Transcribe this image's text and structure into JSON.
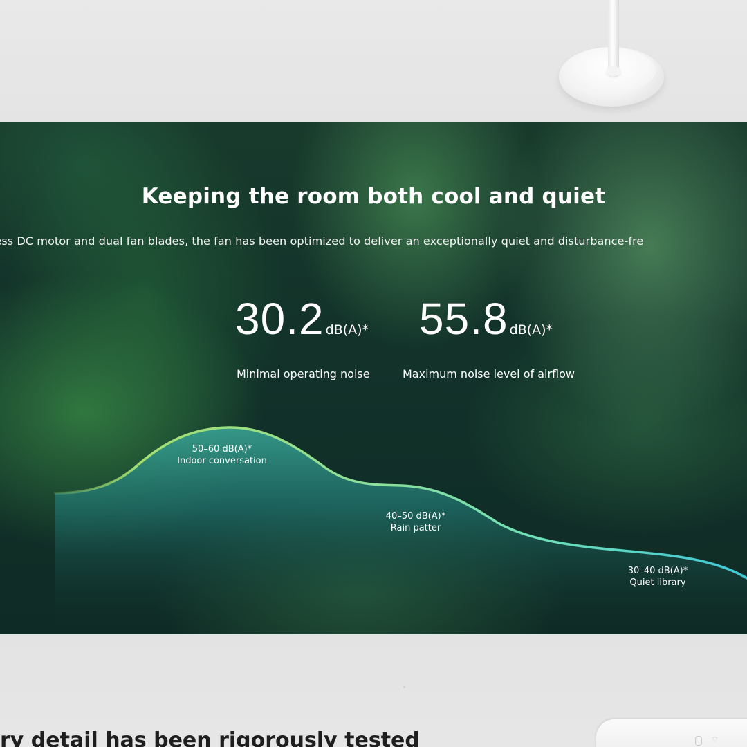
{
  "hero": {
    "title": "Keeping the room both cool and quiet",
    "subtitle": "ts smooth-running brushless DC motor and dual fan blades, the fan has been optimized to deliver an exceptionally quiet and disturbance-fre"
  },
  "stats": [
    {
      "value": "30.2",
      "unit": "dB(A)*",
      "label": "Minimal operating noise"
    },
    {
      "value": "55.8",
      "unit": "dB(A)*",
      "label": "Maximum noise level of airflow"
    }
  ],
  "noise_levels": [
    {
      "range": "50–60 dB(A)*",
      "description": "Indoor conversation"
    },
    {
      "range": "40–50 dB(A)*",
      "description": "Rain patter"
    },
    {
      "range": "30–40 dB(A)*",
      "description": "Quiet library"
    }
  ],
  "bottom": {
    "heading": "ry detail has been rigorously tested"
  },
  "colors": {
    "curve_start": "#a6e070",
    "curve_mid": "#7fe0a8",
    "curve_end": "#3fc8d8",
    "hero_bg": "#12322a",
    "page_bg": "#e6e6e6"
  },
  "icons": [
    "lamp-base",
    "router-device",
    "wifi-icon"
  ]
}
